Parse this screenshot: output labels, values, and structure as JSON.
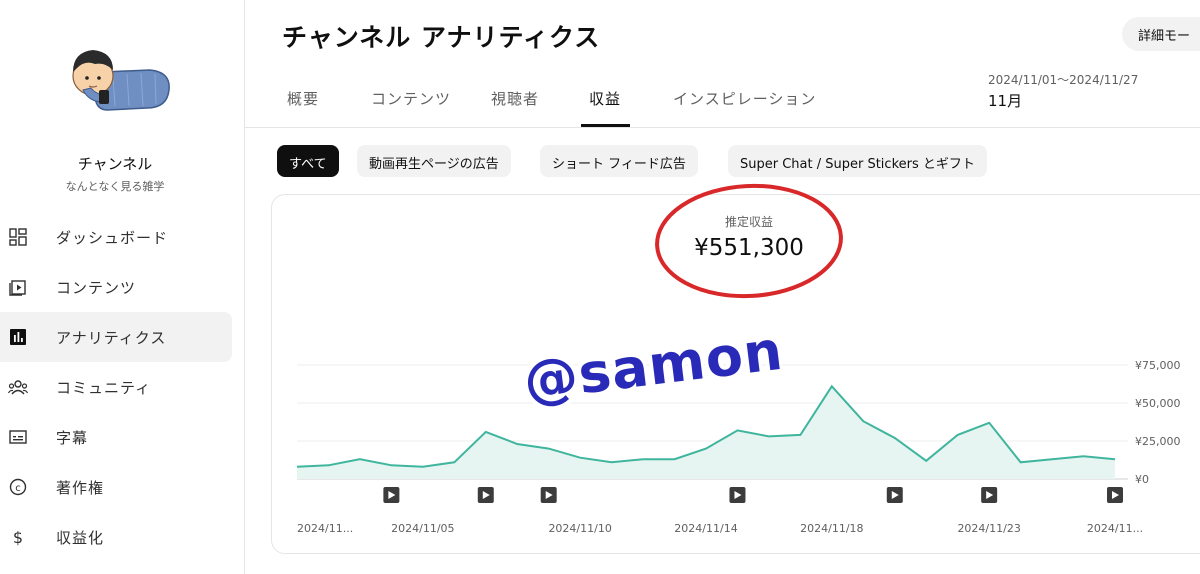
{
  "sidebar": {
    "channel_name": "チャンネル",
    "channel_sub": "なんとなく見る雑学",
    "items": [
      {
        "label": "ダッシュボード",
        "icon": "dashboard-icon"
      },
      {
        "label": "コンテンツ",
        "icon": "content-icon"
      },
      {
        "label": "アナリティクス",
        "icon": "analytics-icon",
        "active": true
      },
      {
        "label": "コミュニティ",
        "icon": "community-icon"
      },
      {
        "label": "字幕",
        "icon": "subtitles-icon"
      },
      {
        "label": "著作権",
        "icon": "copyright-icon"
      },
      {
        "label": "収益化",
        "icon": "monetization-icon"
      }
    ]
  },
  "header": {
    "title": "チャンネル アナリティクス",
    "detail_button": "詳細モー",
    "date_range": "2024/11/01〜2024/11/27",
    "date_period": "11月"
  },
  "tabs": [
    "概要",
    "コンテンツ",
    "視聴者",
    "収益",
    "インスピレーション"
  ],
  "active_tab": "収益",
  "chips": [
    "すべて",
    "動画再生ページの広告",
    "ショート フィード広告",
    "Super Chat / Super Stickers とギフト"
  ],
  "metric": {
    "label": "推定収益",
    "value": "¥551,300"
  },
  "watermark": "@samon",
  "colors": {
    "line": "#3fb59e",
    "area": "#e6f5f1",
    "highlight_circle": "#d8282a",
    "watermark": "#2a2ab8"
  },
  "chart_data": {
    "type": "area",
    "y_tick_labels": [
      "¥75,000",
      "¥50,000",
      "¥25,000",
      "¥0"
    ],
    "ylim": [
      0,
      75000
    ],
    "x_tick_labels": [
      "2024/11...",
      "2024/11/05",
      "2024/11/10",
      "2024/11/14",
      "2024/11/18",
      "2024/11/23",
      "2024/11..."
    ],
    "series": [
      {
        "values": [
          8000,
          9000,
          13000,
          9000,
          8000,
          11000,
          31000,
          23000,
          20000,
          14000,
          11000,
          13000,
          13000,
          20000,
          32000,
          28000,
          29000,
          61000,
          38000,
          27000,
          12000,
          29000,
          37000,
          11000,
          13000,
          15000,
          13000
        ]
      }
    ],
    "video_markers_at": [
      3,
      6,
      8,
      14,
      19,
      22,
      26
    ]
  }
}
